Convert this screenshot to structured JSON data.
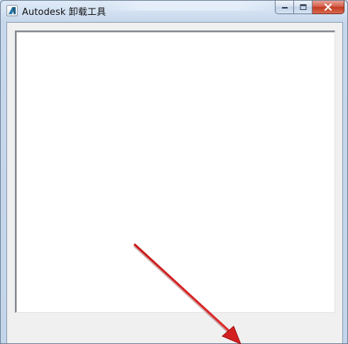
{
  "window": {
    "title": "Autodesk 卸载工具",
    "icon": "autodesk-logo-icon"
  },
  "caption_buttons": {
    "minimize_icon": "minimize-icon",
    "maximize_icon": "maximize-icon",
    "close_icon": "close-icon"
  },
  "list": {
    "items": []
  },
  "annotation": {
    "icon": "red-arrow-icon",
    "color": "#d42020"
  },
  "colors": {
    "client_background": "#f0f0f0",
    "list_background": "#ffffff",
    "close_button": "#c33b22"
  }
}
